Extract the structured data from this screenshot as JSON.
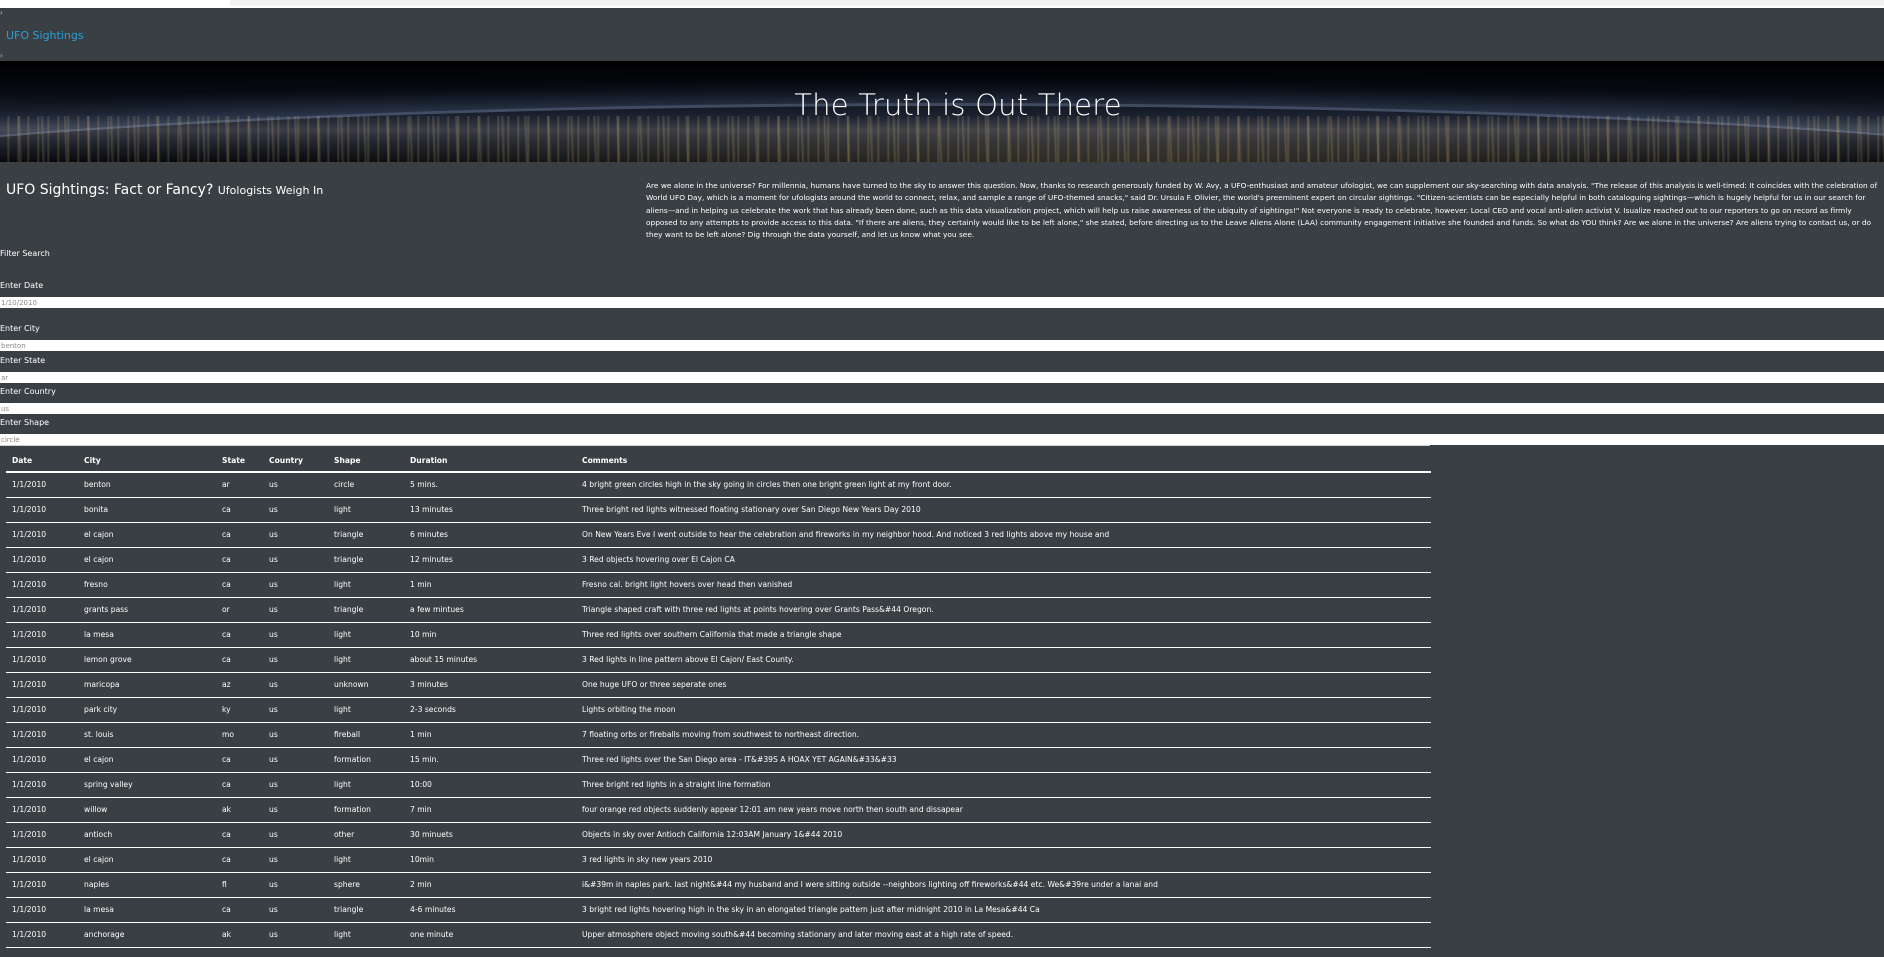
{
  "navbar": {
    "brand": "UFO Sightings",
    "tick_top": "›",
    "tick_bottom": "›"
  },
  "hero": {
    "title": "The Truth is Out There"
  },
  "content": {
    "title": "UFO Sightings: Fact or Fancy?",
    "subtitle": "Ufologists Weigh In",
    "intro": "Are we alone in the universe? For millennia, humans have turned to the sky to answer this question. Now, thanks to research generously funded by W. Avy, a UFO-enthusiast and amateur ufologist, we can supplement our sky-searching with data analysis. \"The release of this analysis is well-timed: It coincides with the celebration of World UFO Day, which is a moment for ufologists around the world to connect, relax, and sample a range of UFO-themed snacks,\" said Dr. Ursula F. Olivier, the world's preeminent expert on circular sightings. \"Citizen-scientists can be especially helpful in both cataloguing sightings—which is hugely helpful for us in our search for aliens—and in helping us celebrate the work that has already been done, such as this data visualization project, which will help us raise awareness of the ubiquity of sightings!\" Not everyone is ready to celebrate, however. Local CEO and vocal anti-alien activist V. Isualize reached out to our reporters to go on record as firmly opposed to any attempts to provide access to this data. \"If there are aliens, they certainly would like to be left alone,\" she stated, before directing us to the Leave Aliens Alone (LAA) community engagement initiative she founded and funds. So what do YOU think? Are we alone in the universe? Are aliens trying to contact us, or do they want to be left alone? Dig through the data yourself, and let us know what you see."
  },
  "filters": {
    "heading": "Filter Search",
    "date": {
      "label": "Enter Date",
      "placeholder": "1/10/2010"
    },
    "city": {
      "label": "Enter City",
      "placeholder": "benton"
    },
    "state": {
      "label": "Enter State",
      "placeholder": "ar"
    },
    "country": {
      "label": "Enter Country",
      "placeholder": "us"
    },
    "shape": {
      "label": "Enter Shape",
      "placeholder": "circle"
    }
  },
  "table": {
    "headers": [
      "Date",
      "City",
      "State",
      "Country",
      "Shape",
      "Duration",
      "Comments"
    ],
    "rows": [
      [
        "1/1/2010",
        "benton",
        "ar",
        "us",
        "circle",
        "5 mins.",
        "4 bright green circles high in the sky going in circles then one bright green light at my front door."
      ],
      [
        "1/1/2010",
        "bonita",
        "ca",
        "us",
        "light",
        "13 minutes",
        "Three bright red lights witnessed floating stationary over San Diego New Years Day 2010"
      ],
      [
        "1/1/2010",
        "el cajon",
        "ca",
        "us",
        "triangle",
        "6 minutes",
        "On New Years Eve I went outside to hear the celebration and fireworks in my neighbor hood. And noticed 3 red lights above my house and"
      ],
      [
        "1/1/2010",
        "el cajon",
        "ca",
        "us",
        "triangle",
        "12 minutes",
        "3 Red objects hovering over El Cajon CA"
      ],
      [
        "1/1/2010",
        "fresno",
        "ca",
        "us",
        "light",
        "1 min",
        "Fresno cal. bright light hovers over head then vanished"
      ],
      [
        "1/1/2010",
        "grants pass",
        "or",
        "us",
        "triangle",
        "a few mintues",
        "Triangle shaped craft with three red lights at points hovering over Grants Pass&#44 Oregon."
      ],
      [
        "1/1/2010",
        "la mesa",
        "ca",
        "us",
        "light",
        "10 min",
        "Three red lights over southern California that made a triangle shape"
      ],
      [
        "1/1/2010",
        "lemon grove",
        "ca",
        "us",
        "light",
        "about 15 minutes",
        "3 Red lights in line pattern above El Cajon/ East County."
      ],
      [
        "1/1/2010",
        "maricopa",
        "az",
        "us",
        "unknown",
        "3 minutes",
        "One huge UFO or three seperate ones"
      ],
      [
        "1/1/2010",
        "park city",
        "ky",
        "us",
        "light",
        "2-3 seconds",
        "Lights orbiting the moon"
      ],
      [
        "1/1/2010",
        "st. louis",
        "mo",
        "us",
        "fireball",
        "1 min",
        "7 floating orbs or fireballs moving from southwest to northeast direction."
      ],
      [
        "1/1/2010",
        "el cajon",
        "ca",
        "us",
        "formation",
        "15 min.",
        "Three red lights over the San Diego area - IT&#39S A HOAX YET AGAIN&#33&#33"
      ],
      [
        "1/1/2010",
        "spring valley",
        "ca",
        "us",
        "light",
        "10:00",
        "Three bright red lights in a straight line formation"
      ],
      [
        "1/1/2010",
        "willow",
        "ak",
        "us",
        "formation",
        "7 min",
        "four orange red objects suddenly appear 12:01 am new years move north then south and dissapear"
      ],
      [
        "1/1/2010",
        "antioch",
        "ca",
        "us",
        "other",
        "30 minuets",
        "Objects in sky over Antioch California 12:03AM January 1&#44 2010"
      ],
      [
        "1/1/2010",
        "el cajon",
        "ca",
        "us",
        "light",
        "10min",
        "3 red lights in sky new years 2010"
      ],
      [
        "1/1/2010",
        "naples",
        "fl",
        "us",
        "sphere",
        "2 min",
        "i&#39m in naples park. last night&#44 my husband and I were sitting outside --neighbors lighting off fireworks&#44 etc. We&#39re under a lanai and"
      ],
      [
        "1/1/2010",
        "la mesa",
        "ca",
        "us",
        "triangle",
        "4-6 minutes",
        "3 bright red lights hovering high in the sky in an elongated triangle pattern just after midnight 2010 in La Mesa&#44 Ca"
      ],
      [
        "1/1/2010",
        "anchorage",
        "ak",
        "us",
        "light",
        "one minute",
        "Upper atmosphere object moving south&#44 becoming stationary and later moving east at a high rate of speed."
      ]
    ]
  },
  "colors": {
    "background": "#3a3f44",
    "brand_link": "#2a9fd6",
    "text": "#ffffff"
  }
}
